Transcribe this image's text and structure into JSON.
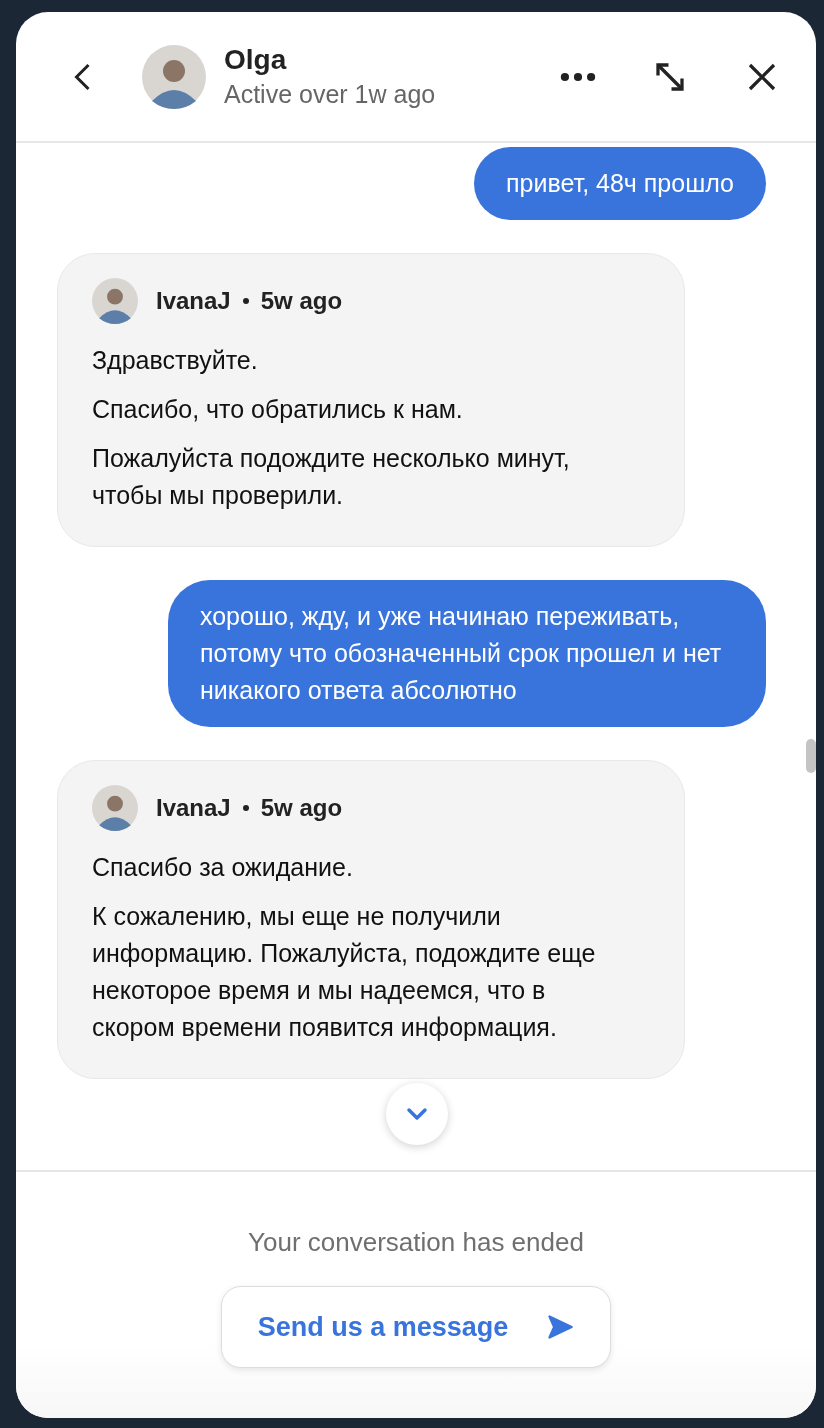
{
  "header": {
    "name": "Olga",
    "status": "Active over 1w ago"
  },
  "messages": [
    {
      "kind": "sent",
      "paragraphs": [
        "привет, 48ч прошло"
      ]
    },
    {
      "kind": "received",
      "author": "IvanaJ",
      "time": "5w ago",
      "paragraphs": [
        "Здравствуйте.",
        "Спасибо, что обратились к нам.",
        "Пожалуйста подождите несколько минут, чтобы мы проверили."
      ]
    },
    {
      "kind": "sent",
      "paragraphs": [
        "хорошо, жду, и уже начинаю переживать, потому что обозначенный срок прошел и нет никакого ответа абсолютно"
      ]
    },
    {
      "kind": "received",
      "author": "IvanaJ",
      "time": "5w ago",
      "paragraphs": [
        "Спасибо за ожидание.",
        "К сожалению, мы еще не получили информацию. Пожалуйста, подождите еще некоторое время и мы надеемся, что в скором времени появится информация."
      ]
    }
  ],
  "footer": {
    "notice": "Your conversation has ended",
    "button": "Send us a message"
  }
}
